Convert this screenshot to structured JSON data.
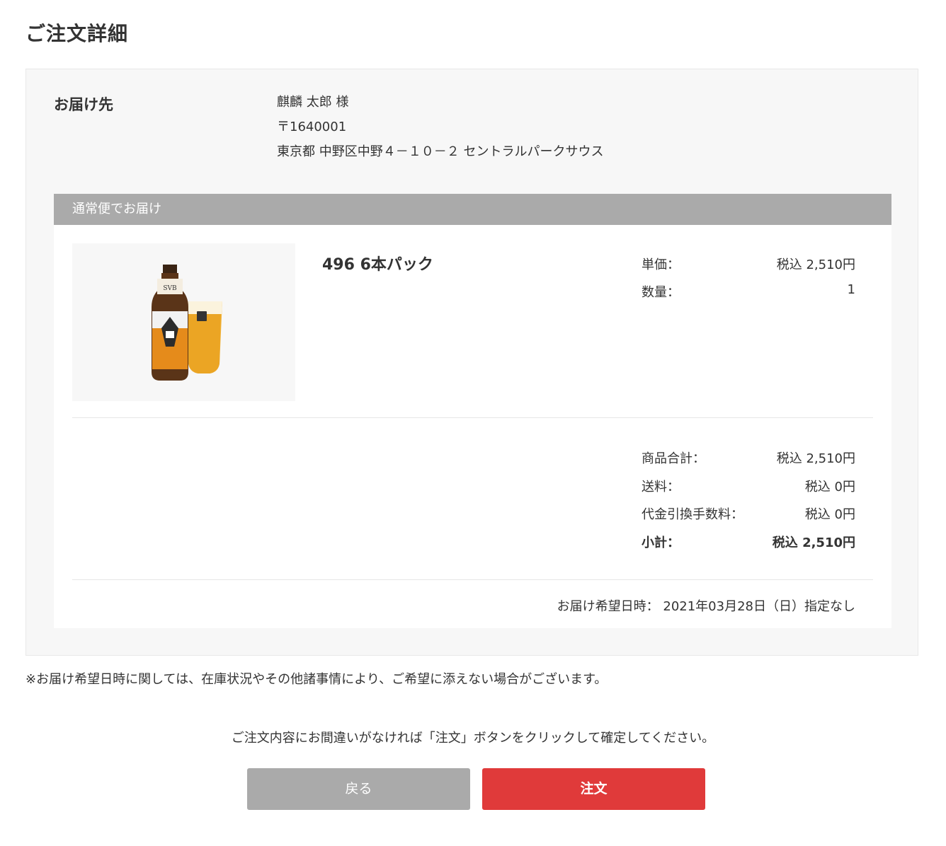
{
  "page": {
    "title": "ご注文詳細"
  },
  "address": {
    "label": "お届け先",
    "name": "麒麟 太郎 様",
    "postal": "〒1640001",
    "address": "東京都 中野区中野４－１０－２ セントラルパークサウス"
  },
  "shipping": {
    "method": "通常便でお届け",
    "product": {
      "name": "496 6本パック",
      "image_icon": "beer-bottle-and-glass-image",
      "unit_price_label": "単価：",
      "unit_price": "税込 2,510円",
      "quantity_label": "数量：",
      "quantity": "1"
    },
    "totals": {
      "subtotal_items_label": "商品合計：",
      "subtotal_items": "税込 2,510円",
      "shipping_fee_label": "送料：",
      "shipping_fee": "税込 0円",
      "cod_fee_label": "代金引換手数料：",
      "cod_fee": "税込 0円",
      "subtotal_label": "小計：",
      "subtotal": "税込 2,510円"
    },
    "delivery_date": "お届け希望日時： 2021年03月28日（日）指定なし"
  },
  "note": "※お届け希望日時に関しては、在庫状況やその他諸事情により、ご希望に添えない場合がございます。",
  "confirm_message": "ご注文内容にお間違いがなければ「注文」ボタンをクリックして確定してください。",
  "buttons": {
    "back": "戻る",
    "order": "注文"
  },
  "colors": {
    "order_button": "#e03a3a",
    "back_button": "#aaaaaa",
    "ship_header": "#aaaaaa",
    "panel_bg": "#f7f7f7"
  }
}
